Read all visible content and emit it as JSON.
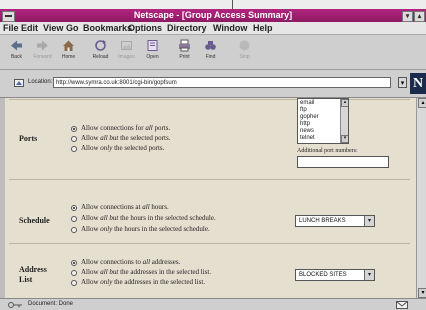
{
  "window": {
    "title": "Netscape - [Group Access Summary]"
  },
  "menu": [
    "File",
    "Edit",
    "View",
    "Go",
    "Bookmarks",
    "Options",
    "Directory",
    "Window",
    "Help"
  ],
  "toolbar": [
    {
      "label": "Back",
      "icon": "back-arrow-icon",
      "enabled": true
    },
    {
      "label": "Forward",
      "icon": "forward-arrow-icon",
      "enabled": false
    },
    {
      "label": "Home",
      "icon": "home-icon",
      "enabled": true
    },
    {
      "label": "Reload",
      "icon": "reload-icon",
      "enabled": true
    },
    {
      "label": "Images",
      "icon": "images-icon",
      "enabled": false
    },
    {
      "label": "Open",
      "icon": "open-icon",
      "enabled": true
    },
    {
      "label": "Print",
      "icon": "print-icon",
      "enabled": true
    },
    {
      "label": "Find",
      "icon": "find-icon",
      "enabled": true
    },
    {
      "label": "Stop",
      "icon": "stop-icon",
      "enabled": false
    }
  ],
  "location": {
    "label": "Location:",
    "url": "http://www.symra.co.uk:8001/cgi-bin/gopfsum",
    "logo": "N"
  },
  "ports": {
    "label": "Ports",
    "list": [
      "email",
      "ftp",
      "gopher",
      "http",
      "news",
      "telnet"
    ],
    "additional_label": "Additional port numbers:",
    "additional_value": "",
    "options": [
      {
        "pre": "Allow connections for ",
        "em": "all",
        "post": " ports.",
        "selected": true
      },
      {
        "pre": "Allow ",
        "em": "all but",
        "post": " the selected ports.",
        "selected": false
      },
      {
        "pre": "Allow ",
        "em": "only",
        "post": " the selected ports.",
        "selected": false
      }
    ]
  },
  "schedule": {
    "label": "Schedule",
    "select_value": "LUNCH BREAKS",
    "options": [
      {
        "pre": "Allow connections at ",
        "em": "all",
        "post": " hours.",
        "selected": true
      },
      {
        "pre": "Allow ",
        "em": "all but",
        "post": " the hours in the selected schedule.",
        "selected": false
      },
      {
        "pre": "Allow ",
        "em": "only",
        "post": " the hours in the selected schedule.",
        "selected": false
      }
    ]
  },
  "address": {
    "label_line1": "Address",
    "label_line2": "List",
    "select_value": "BLOCKED SITES",
    "options": [
      {
        "pre": "Allow connections to ",
        "em": "all",
        "post": " addresses.",
        "selected": true
      },
      {
        "pre": "Allow ",
        "em": "all but",
        "post": " the addresses in the selected list.",
        "selected": false
      },
      {
        "pre": "Allow ",
        "em": "only",
        "post": " the addresses in the selected list.",
        "selected": false
      }
    ]
  },
  "status": {
    "message": "Document: Done"
  },
  "colors": {
    "titlebar": "#9b1f6f",
    "page_background": "#e5dfd0"
  }
}
